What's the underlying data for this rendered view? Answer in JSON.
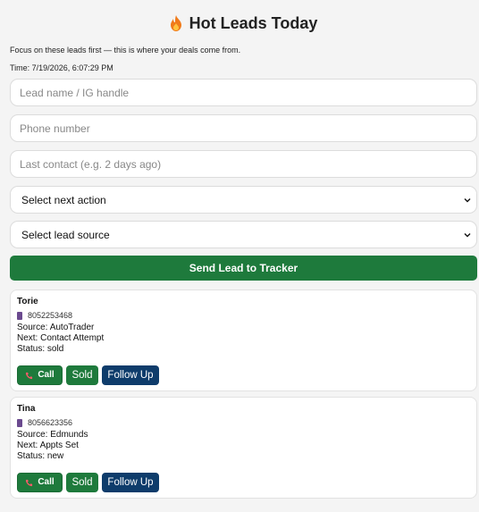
{
  "header": {
    "title": "Hot Leads Today",
    "tagline": "Focus on these leads first — this is where your deals come from.",
    "time": "Time: 7/19/2026, 6:07:29 PM"
  },
  "form": {
    "name_placeholder": "Lead name / IG handle",
    "phone_placeholder": "Phone number",
    "last_contact_placeholder": "Last contact (e.g. 2 days ago)",
    "next_action_value": "Select next action",
    "lead_source_value": "Select lead source",
    "submit_label": "Send Lead to Tracker"
  },
  "leads": [
    {
      "name": "Torie",
      "phone": "8052253468",
      "source": "Source: AutoTrader",
      "next": "Next: Contact Attempt",
      "status": "Status: sold",
      "call_label": "Call",
      "sold_label": "Sold",
      "follow_label": "Follow Up"
    },
    {
      "name": "Tina",
      "phone": "8056623356",
      "source": "Source: Edmunds",
      "next": "Next: Appts Set",
      "status": "Status: new",
      "call_label": "Call",
      "sold_label": "Sold",
      "follow_label": "Follow Up"
    }
  ],
  "colors": {
    "primary_green": "#1e7a3c",
    "follow_up_blue": "#0e3c6b",
    "flame": "#f07a1a"
  },
  "icons": {
    "title": "fire-icon",
    "phone": "phone-icon",
    "call": "handset-icon",
    "select": "chevron-down-icon"
  }
}
